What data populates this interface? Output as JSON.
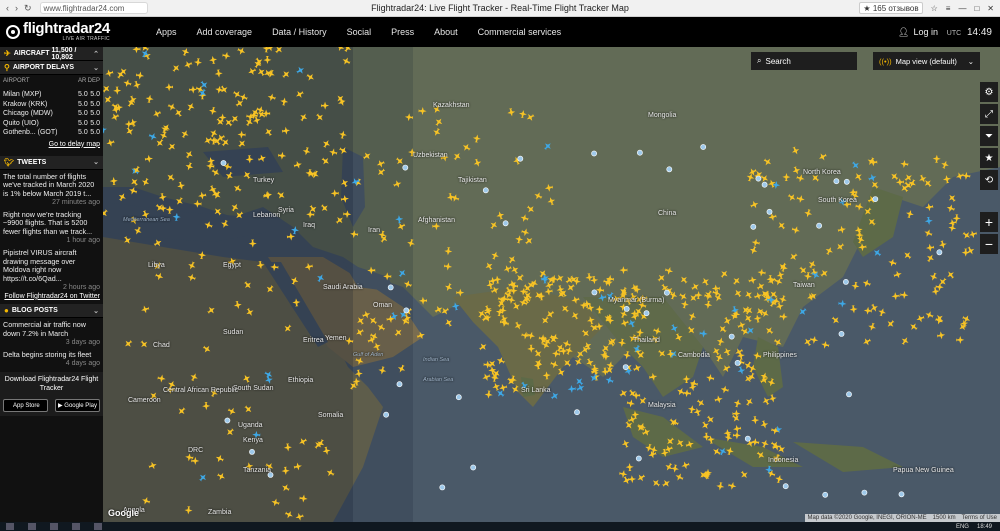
{
  "browser": {
    "url": "www.flightradar24.com",
    "title": "Flightradar24: Live Flight Tracker - Real-Time Flight Tracker Map",
    "reviews": "★ 165 отзывов"
  },
  "topnav": {
    "logo": "flightradar24",
    "tagline": "LIVE AIR TRAFFIC",
    "menu": [
      "Apps",
      "Add coverage",
      "Data / History",
      "Social",
      "Press",
      "About",
      "Commercial services"
    ],
    "login": "Log in",
    "utc_label": "UTC",
    "time": "14:49"
  },
  "sidebar": {
    "aircraft_label": "AIRCRAFT",
    "aircraft_count": "11,500 / 10,802",
    "delays_title": "AIRPORT DELAYS",
    "delays_cols": {
      "airport": "AIRPORT",
      "arr": "AR",
      "dep": "DEP",
      "r": "R"
    },
    "delays": [
      {
        "airport": "Milan (MXP)",
        "arr": "5.0",
        "dep": "5.0"
      },
      {
        "airport": "Krakow (KRK)",
        "arr": "5.0",
        "dep": "5.0"
      },
      {
        "airport": "Chicago (MDW)",
        "arr": "5.0",
        "dep": "5.0"
      },
      {
        "airport": "Quito (UIO)",
        "arr": "5.0",
        "dep": "5.0"
      },
      {
        "airport": "Gothenb... (GOT)",
        "arr": "5.0",
        "dep": "5.0"
      }
    ],
    "delay_link": "Go to delay map",
    "tweets_title": "TWEETS",
    "tweets": [
      {
        "text": "The total number of flights we've tracked in March 2020 is 1% below March 2019 t...",
        "time": "27 minutes ago"
      },
      {
        "text": "Right now we're tracking ~9900 flights. That is 5200 fewer flights than we track...",
        "time": "1 hour ago"
      },
      {
        "text": "Pipistrel VIRUS aircraft drawing message over Moldova right now https://t.co/6Qad...",
        "time": "2 hours ago"
      }
    ],
    "follow_link": "Follow Flightradar24 on Twitter",
    "blog_title": "BLOG POSTS",
    "posts": [
      {
        "text": "Commercial air traffic now down 7.2% in March",
        "time": "3 days ago"
      },
      {
        "text": "Delta begins storing its fleet",
        "time": "4 days ago"
      }
    ],
    "download_text": "Download Flightradar24 Flight Tracker",
    "app_store": "App Store",
    "google_play": "Google Play"
  },
  "map": {
    "search_placeholder": "Search",
    "map_view": "Map view (default)",
    "google": "Google",
    "attribution": "Map data ©2020 Google, INEGI, ORION-ME",
    "scale": "1500 km",
    "terms": "Terms of Use",
    "labels": [
      {
        "text": "Kazakhstan",
        "cls": "land"
      },
      {
        "text": "Mongolia",
        "cls": "land"
      },
      {
        "text": "Uzbekistan",
        "cls": "land"
      },
      {
        "text": "Tajikistan",
        "cls": "land"
      },
      {
        "text": "Turkey",
        "cls": "land"
      },
      {
        "text": "Afghanistan",
        "cls": "land"
      },
      {
        "text": "Iran",
        "cls": "land"
      },
      {
        "text": "Iraq",
        "cls": "land"
      },
      {
        "text": "Syria",
        "cls": "land"
      },
      {
        "text": "China",
        "cls": "land"
      },
      {
        "text": "North Korea",
        "cls": "land"
      },
      {
        "text": "South Korea",
        "cls": "land"
      },
      {
        "text": "Libya",
        "cls": "land"
      },
      {
        "text": "Egypt",
        "cls": "land"
      },
      {
        "text": "Saudi Arabia",
        "cls": "land"
      },
      {
        "text": "Sudan",
        "cls": "land"
      },
      {
        "text": "Chad",
        "cls": "land"
      },
      {
        "text": "Yemen",
        "cls": "land"
      },
      {
        "text": "Eritrea",
        "cls": "land"
      },
      {
        "text": "South Sudan",
        "cls": "land"
      },
      {
        "text": "Ethiopia",
        "cls": "land"
      },
      {
        "text": "Central African Republic",
        "cls": "land"
      },
      {
        "text": "Cameroon",
        "cls": "land"
      },
      {
        "text": "Somalia",
        "cls": "land"
      },
      {
        "text": "Kenya",
        "cls": "land"
      },
      {
        "text": "Uganda",
        "cls": "land"
      },
      {
        "text": "DRC",
        "cls": "land"
      },
      {
        "text": "Tanzania",
        "cls": "land"
      },
      {
        "text": "Angola",
        "cls": "land"
      },
      {
        "text": "Zambia",
        "cls": "land"
      },
      {
        "text": "Myanmar (Burma)",
        "cls": "land"
      },
      {
        "text": "Thailand",
        "cls": "land"
      },
      {
        "text": "Cambodia",
        "cls": "land"
      },
      {
        "text": "Philippines",
        "cls": "land"
      },
      {
        "text": "Malaysia",
        "cls": "land"
      },
      {
        "text": "Indonesia",
        "cls": "land"
      },
      {
        "text": "Papua New Guinea",
        "cls": "land"
      },
      {
        "text": "Sri Lanka",
        "cls": "land"
      },
      {
        "text": "Mediterranean Sea",
        "cls": "sea"
      },
      {
        "text": "Arabian Sea",
        "cls": "sea"
      },
      {
        "text": "Indian Sea",
        "cls": "sea"
      },
      {
        "text": "Gulf of Aden",
        "cls": "sea"
      },
      {
        "text": "Taiwan",
        "cls": "land"
      },
      {
        "text": "Oman",
        "cls": "land"
      },
      {
        "text": "Lebanon",
        "cls": "land"
      }
    ]
  },
  "taskbar": {
    "lang": "ENG",
    "time": "18:49"
  }
}
